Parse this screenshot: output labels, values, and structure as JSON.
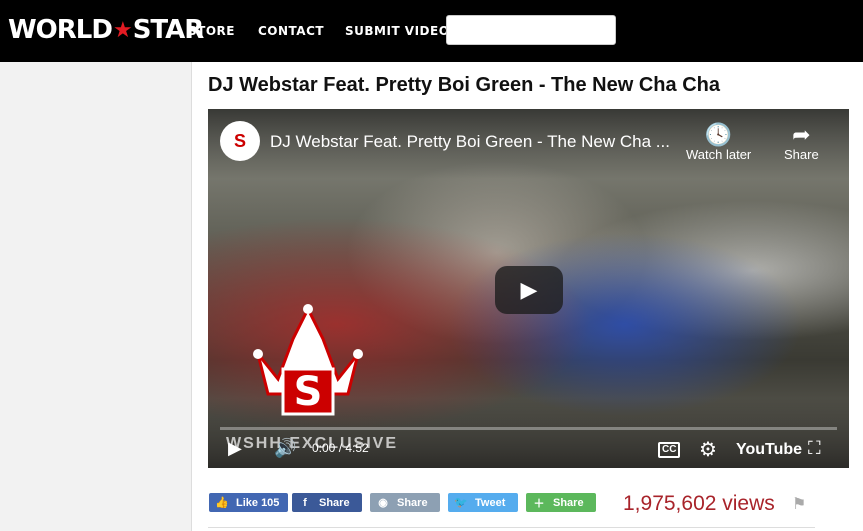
{
  "header": {
    "logo_left": "WORLD",
    "logo_right": "STAR",
    "nav": [
      "STORE",
      "CONTACT",
      "SUBMIT VIDEO"
    ],
    "search_placeholder": ""
  },
  "page": {
    "title": "DJ Webstar Feat. Pretty Boi Green - The New Cha Cha"
  },
  "player": {
    "channel_logo_text": "S",
    "video_title": "DJ Webstar Feat. Pretty Boi Green - The New Cha ...",
    "watch_later": "Watch later",
    "share": "Share",
    "watermark": "WSHH EXCLUSIVE",
    "time": "0:00 / 4:52",
    "cc": "CC",
    "youtube": "YouTube"
  },
  "social": {
    "like": "Like 105",
    "fb_share": "Share",
    "reddit_share": "Share",
    "tweet": "Tweet",
    "more_share": "Share"
  },
  "stats": {
    "views": "1,975,602 views"
  },
  "colors": {
    "accent_red": "#a8232a",
    "facebook": "#3b5998",
    "twitter": "#55acee",
    "more": "#5cb85c"
  }
}
